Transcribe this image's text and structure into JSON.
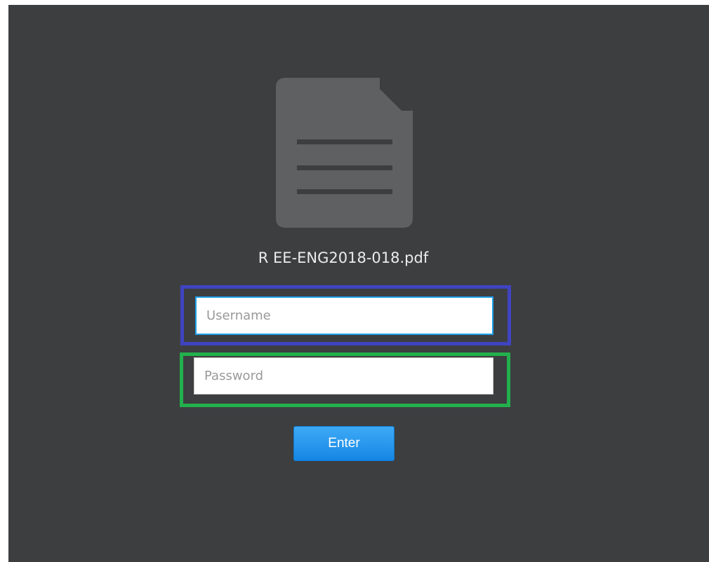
{
  "file": {
    "icon": "document-icon",
    "name": "R EE-ENG2018-018.pdf"
  },
  "username": {
    "placeholder": "Username",
    "value": ""
  },
  "password": {
    "placeholder": "Password",
    "value": ""
  },
  "submit": {
    "label": "Enter"
  },
  "colors": {
    "background": "#3d3e40",
    "icon": "#5e6062",
    "focus_border": "#1ea0ea",
    "button": "#2196f3",
    "highlight_username": "#3f44c0",
    "highlight_password": "#22b14c"
  }
}
